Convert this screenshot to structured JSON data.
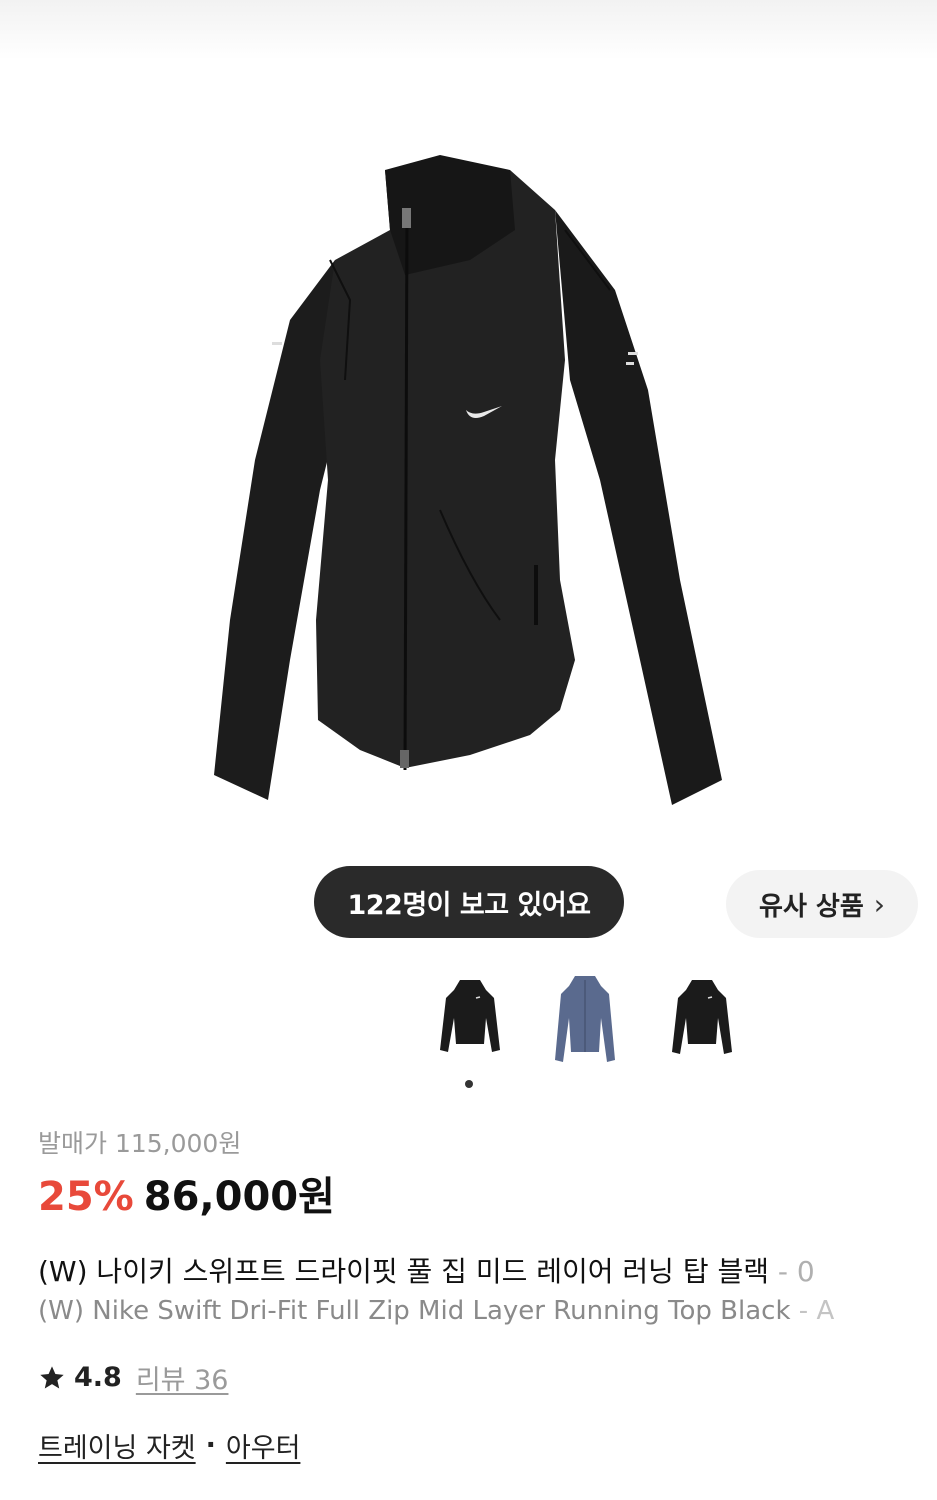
{
  "product_image": {
    "alt_icon": "jacket-image"
  },
  "badges": {
    "viewers_text": "122명이 보고 있어요",
    "similar_label": "유사 상품",
    "similar_chevron": "›"
  },
  "thumbnails": [
    {
      "color_name": "black",
      "fill": "#1b1b1b"
    },
    {
      "color_name": "blue",
      "fill": "#5a6a8e"
    },
    {
      "color_name": "black",
      "fill": "#1b1b1b"
    }
  ],
  "pricing": {
    "original_label": "발매가 115,000원",
    "discount": "25%",
    "sale_price": "86,000원",
    "discount_color": "#e8493a"
  },
  "title": {
    "korean": "(W) 나이키 스위프트 드라이핏 풀 집 미드 레이어 러닝 탑 블랙",
    "korean_suffix": " - 0",
    "english": "(W) Nike Swift Dri-Fit Full Zip Mid Layer Running Top Black",
    "english_suffix": " - A"
  },
  "rating": {
    "score": "4.8",
    "review_label": "리뷰 36"
  },
  "categories": {
    "primary": "트레이닝 자켓",
    "separator": "·",
    "secondary": "아우터"
  }
}
